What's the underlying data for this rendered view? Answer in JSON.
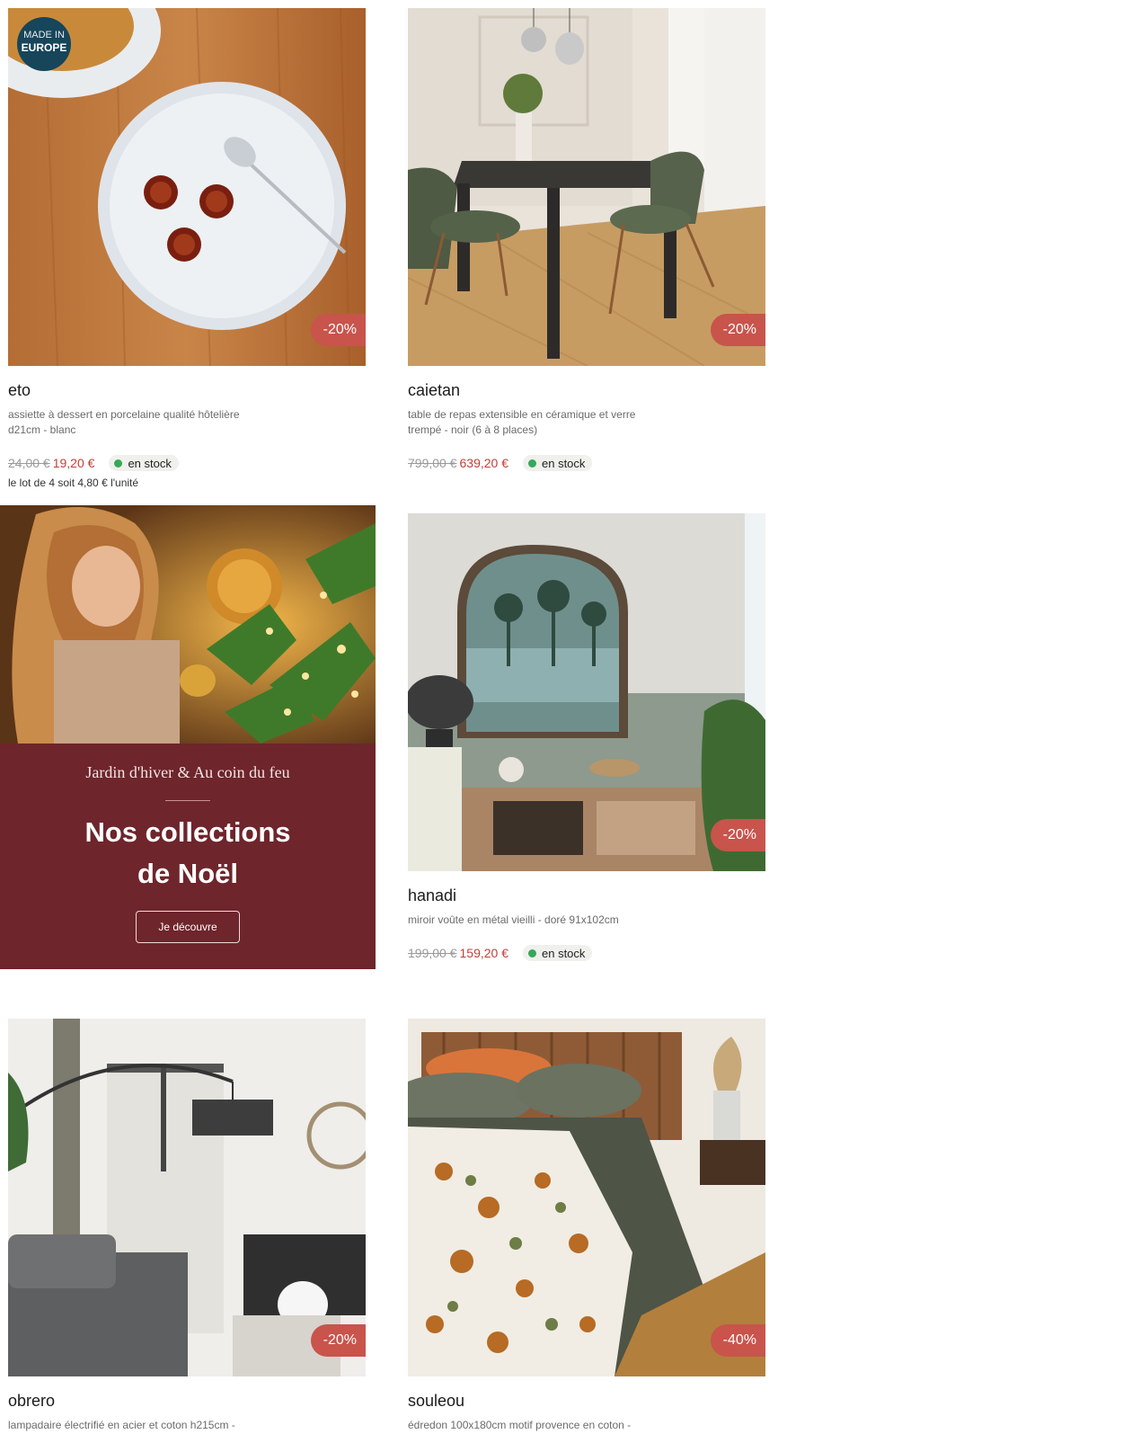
{
  "made_in_badge": {
    "line1": "MADE IN",
    "line2": "EUROPE"
  },
  "products": [
    {
      "name": "eto",
      "desc": "assiette à dessert en porcelaine qualité hôtelière d21cm - blanc",
      "old_price": "24,00 €",
      "new_price": "19,20 €",
      "stock": "en stock",
      "discount": "-20%",
      "lot": "le lot de 4 soit 4,80 € l'unité"
    },
    {
      "name": "caietan",
      "desc": "table de repas extensible en céramique et verre trempé - noir (6 à 8 places)",
      "old_price": "799,00 €",
      "new_price": "639,20 €",
      "stock": "en stock",
      "discount": "-20%"
    },
    {
      "name": "hanadi",
      "desc": "miroir voûte en métal vieilli - doré 91x102cm",
      "old_price": "199,00 €",
      "new_price": "159,20 €",
      "stock": "en stock",
      "discount": "-20%"
    },
    {
      "name": "obrero",
      "desc": "lampadaire électrifié en acier et coton h215cm -",
      "discount": "-20%"
    },
    {
      "name": "souleou",
      "desc": "édredon 100x180cm motif provence en coton -",
      "discount": "-40%"
    }
  ],
  "promo": {
    "subtitle": "Jardin d'hiver & Au coin du feu",
    "title_line1": "Nos collections",
    "title_line2": "de Noël",
    "button": "Je découvre"
  },
  "colors": {
    "discount_badge": "#c8544c",
    "promo_panel": "#6e252b",
    "sale_price": "#c14038",
    "stock_dot": "#36a85a"
  }
}
